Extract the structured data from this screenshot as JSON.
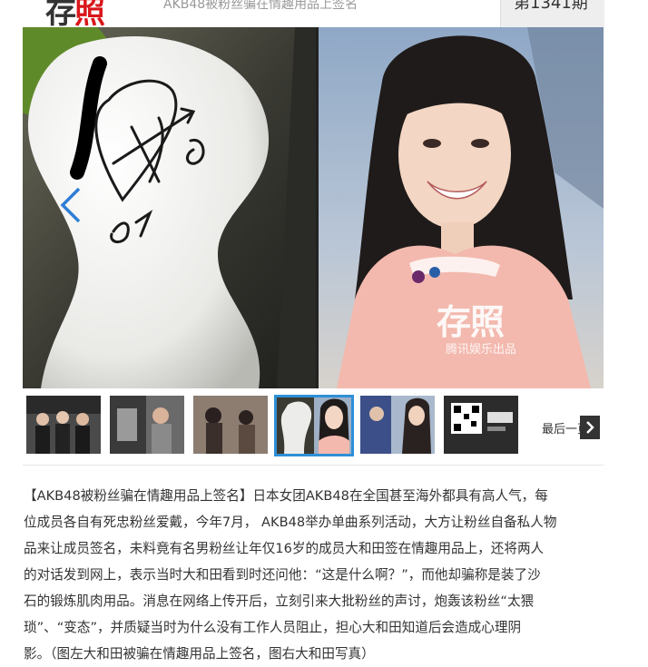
{
  "header": {
    "logo_text_dark": "存",
    "logo_text_red": "照",
    "breadcrumb": "AKB48被粉丝骗在情趣用品上签名",
    "issue_label": "第1341期"
  },
  "gallery": {
    "right_watermark": "存照",
    "right_watermark_sub": "腾讯娱乐出品",
    "thumbnails": [
      {
        "name": "thumb-1"
      },
      {
        "name": "thumb-2"
      },
      {
        "name": "thumb-3"
      },
      {
        "name": "thumb-4",
        "active": true
      },
      {
        "name": "thumb-5"
      },
      {
        "name": "thumb-6"
      }
    ],
    "last_page_label": "最后一页",
    "active_border_color": "#2e8fd6"
  },
  "article": {
    "lines": [
      "【AKB48被粉丝骗在情趣用品上签名】日本女团AKB48在全国甚至海外都具有高人气，每",
      "位成员各自有死忠粉丝爱戴，今年7月， AKB48举办单曲系列活动，大方让粉丝自备私人物",
      "品来让成员签名，未料竟有名男粉丝让年仅16岁的成员大和田签在情趣用品上，还将两人",
      "的对话发到网上，表示当时大和田看到时还问他：“这是什么啊？”，而他却骗称是装了沙",
      "石的锻炼肌肉用品。消息在网络上传开后，立刻引来大批粉丝的声讨，炮轰该粉丝“太猥",
      "琐”、“变态”，并质疑当时为什么没有工作人员阻止，担心大和田知道后会造成心理阴",
      "影。（图左大和田被骗在情趣用品上签名，图右大和田写真）"
    ]
  }
}
